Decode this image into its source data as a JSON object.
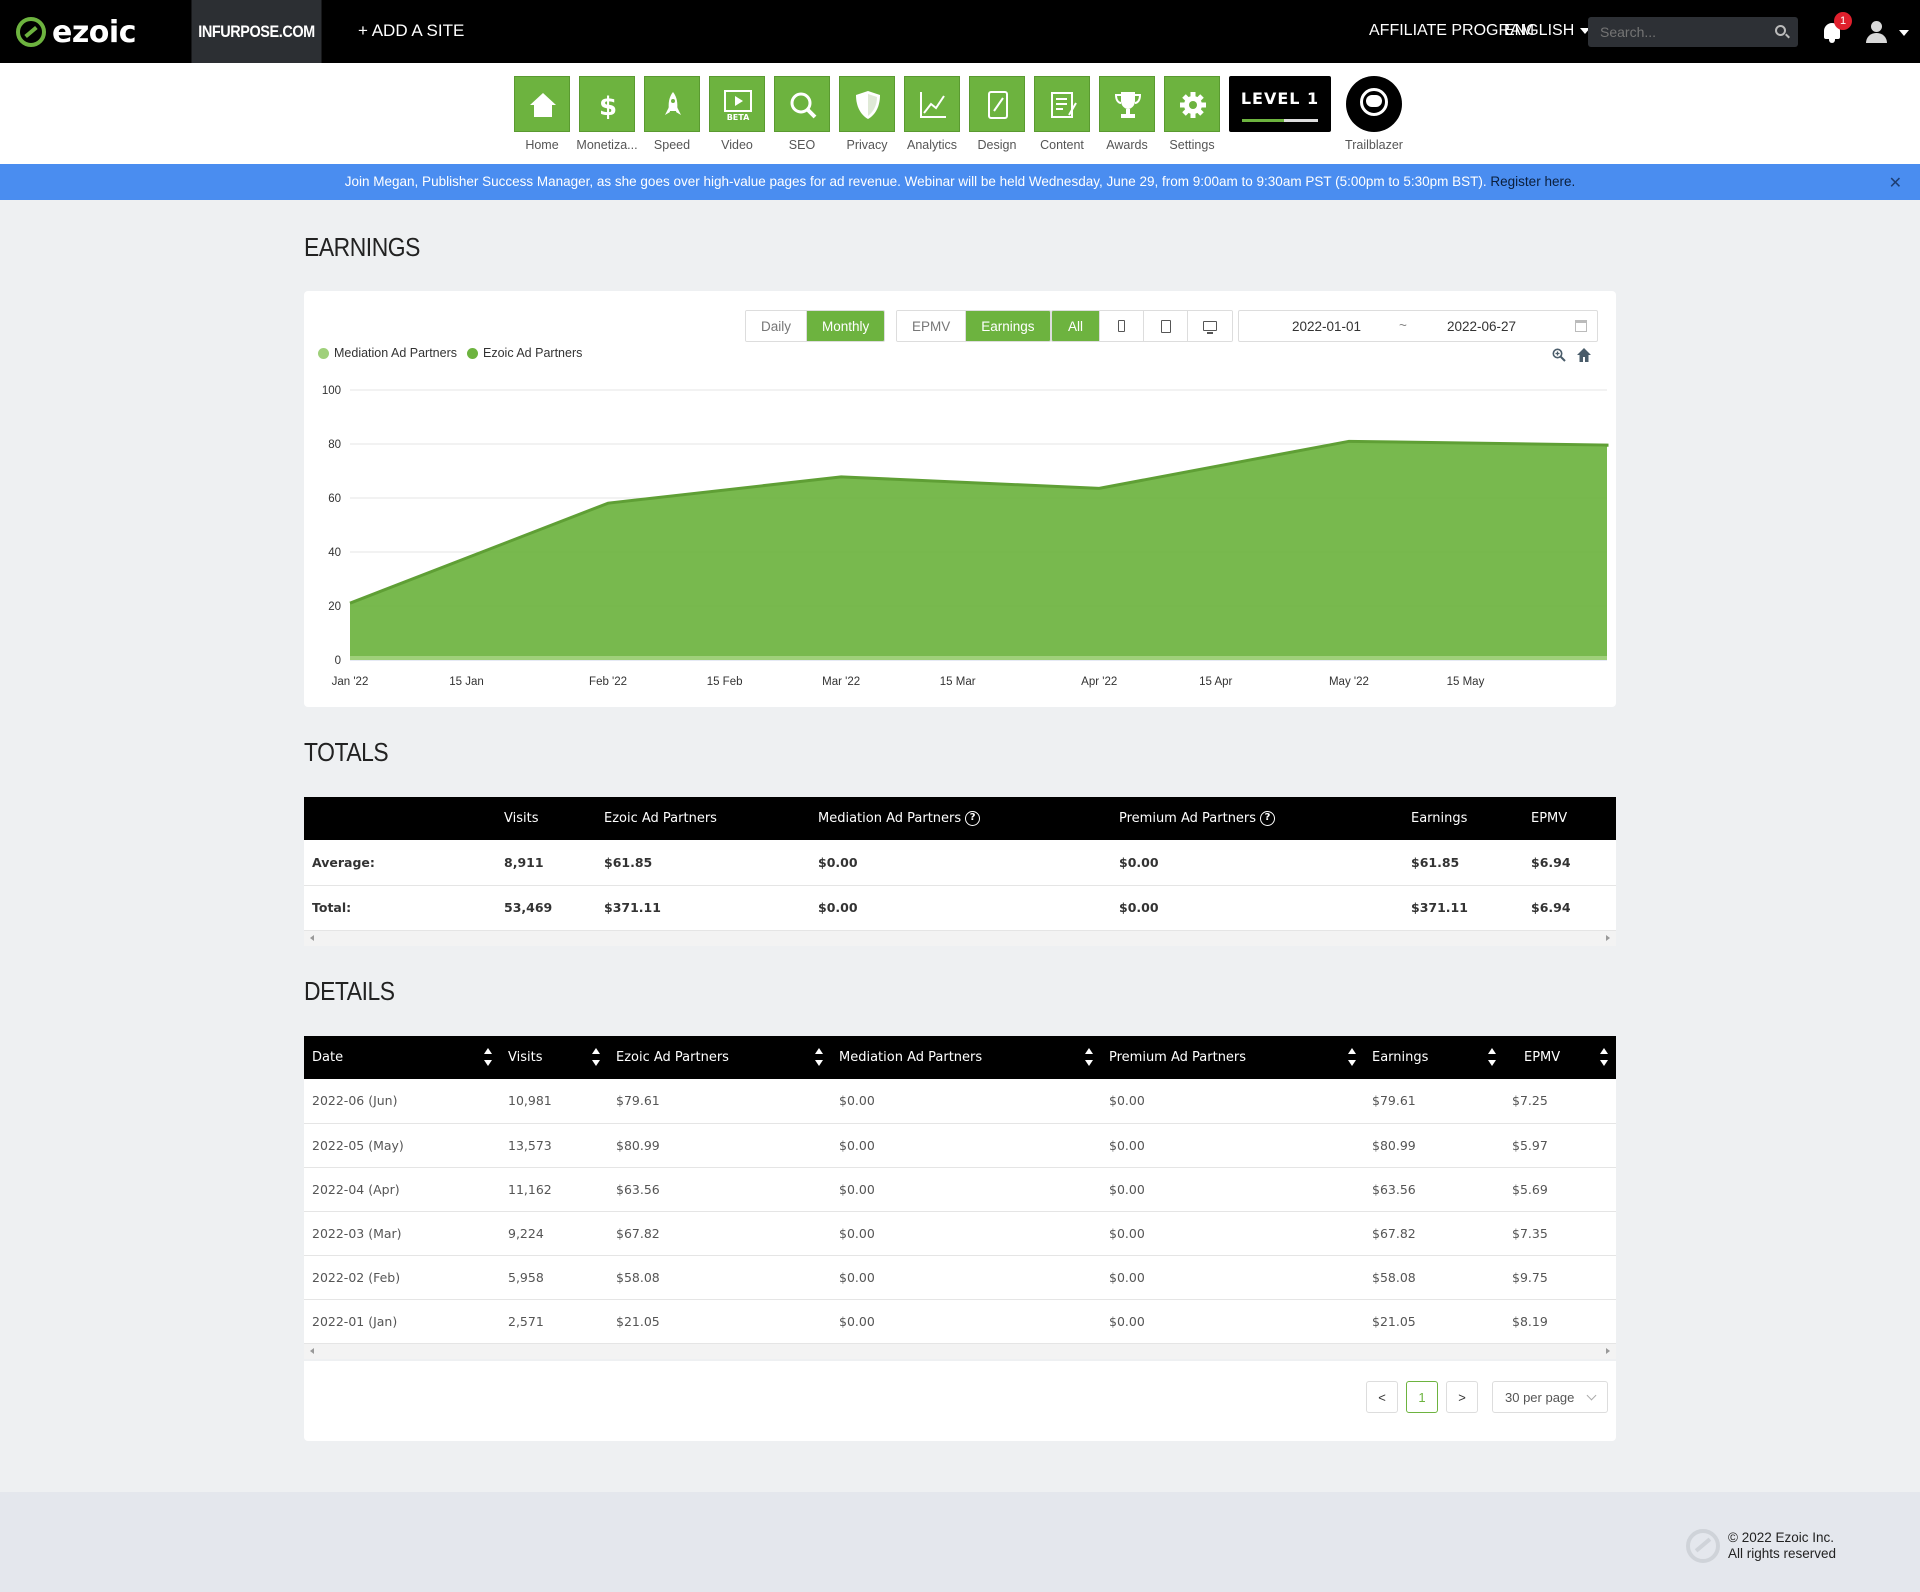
{
  "header": {
    "brand": "ezoic",
    "site": "INFURPOSE.COM",
    "add_site": "+ ADD A SITE",
    "affiliate": "AFFILIATE PROGRAM",
    "language": "ENGLISH",
    "search_placeholder": "Search...",
    "notifications": "1"
  },
  "nav": {
    "items": [
      {
        "label": "Home",
        "icon": "home-icon"
      },
      {
        "label": "Monetiza...",
        "icon": "dollar-icon"
      },
      {
        "label": "Speed",
        "icon": "rocket-icon"
      },
      {
        "label": "Video",
        "icon": "video-icon",
        "badge": "BETA"
      },
      {
        "label": "SEO",
        "icon": "magnifier-icon"
      },
      {
        "label": "Privacy",
        "icon": "shield-icon"
      },
      {
        "label": "Analytics",
        "icon": "line-chart-icon"
      },
      {
        "label": "Design",
        "icon": "design-icon"
      },
      {
        "label": "Content",
        "icon": "document-icon"
      },
      {
        "label": "Awards",
        "icon": "trophy-icon"
      },
      {
        "label": "Settings",
        "icon": "gear-icon"
      }
    ],
    "level": "LEVEL 1",
    "level_progress": 0.55,
    "trailblazer": "Trailblazer"
  },
  "announcement": {
    "text": "Join Megan, Publisher Success Manager, as she goes over high-value pages for ad revenue. Webinar will be held Wednesday, June 29, from 9:00am to 9:30am PST (5:00pm to 5:30pm BST).",
    "link": "Register here."
  },
  "earnings": {
    "title": "EARNINGS",
    "period_buttons": [
      "Daily",
      "Monthly"
    ],
    "metric_buttons": [
      "EPMV",
      "Earnings"
    ],
    "device_all": "All",
    "date_from": "2022-01-01",
    "date_sep": "~",
    "date_to": "2022-06-27"
  },
  "chart_data": {
    "type": "area",
    "legend": [
      "Mediation Ad Partners",
      "Ezoic Ad Partners"
    ],
    "colors": {
      "Mediation Ad Partners": "#9fd07a",
      "Ezoic Ad Partners": "#6db33f"
    },
    "x_ticks": [
      "Jan '22",
      "15 Jan",
      "Feb '22",
      "15 Feb",
      "Mar '22",
      "15 Mar",
      "Apr '22",
      "15 Apr",
      "May '22",
      "15 May"
    ],
    "y_ticks": [
      "0",
      "20",
      "40",
      "60",
      "80",
      "100"
    ],
    "ylim": [
      0,
      100
    ],
    "series": [
      {
        "name": "Ezoic Ad Partners",
        "dates": [
          "2022-01-01",
          "2022-02-01",
          "2022-03-01",
          "2022-04-01",
          "2022-05-01",
          "2022-06-01"
        ],
        "values": [
          21.05,
          58.08,
          67.82,
          63.56,
          80.99,
          79.61
        ]
      },
      {
        "name": "Mediation Ad Partners",
        "dates": [
          "2022-01-01",
          "2022-02-01",
          "2022-03-01",
          "2022-04-01",
          "2022-05-01",
          "2022-06-01"
        ],
        "values": [
          0,
          0,
          0,
          0,
          0,
          0
        ]
      }
    ],
    "legend_position": "top-left",
    "grid": true
  },
  "totals": {
    "title": "TOTALS",
    "columns": [
      "",
      "Visits",
      "Ezoic Ad Partners",
      "Mediation Ad Partners",
      "Premium Ad Partners",
      "Earnings",
      "EPMV"
    ],
    "rows": [
      [
        "Average:",
        "8,911",
        "$61.85",
        "$0.00",
        "$0.00",
        "$61.85",
        "$6.94"
      ],
      [
        "Total:",
        "53,469",
        "$371.11",
        "$0.00",
        "$0.00",
        "$371.11",
        "$6.94"
      ]
    ]
  },
  "details": {
    "title": "DETAILS",
    "columns": [
      "Date",
      "Visits",
      "Ezoic Ad Partners",
      "Mediation Ad Partners",
      "Premium Ad Partners",
      "Earnings",
      "EPMV"
    ],
    "rows": [
      [
        "2022-06 (Jun)",
        "10,981",
        "$79.61",
        "$0.00",
        "$0.00",
        "$79.61",
        "$7.25"
      ],
      [
        "2022-05 (May)",
        "13,573",
        "$80.99",
        "$0.00",
        "$0.00",
        "$80.99",
        "$5.97"
      ],
      [
        "2022-04 (Apr)",
        "11,162",
        "$63.56",
        "$0.00",
        "$0.00",
        "$63.56",
        "$5.69"
      ],
      [
        "2022-03 (Mar)",
        "9,224",
        "$67.82",
        "$0.00",
        "$0.00",
        "$67.82",
        "$7.35"
      ],
      [
        "2022-02 (Feb)",
        "5,958",
        "$58.08",
        "$0.00",
        "$0.00",
        "$58.08",
        "$9.75"
      ],
      [
        "2022-01 (Jan)",
        "2,571",
        "$21.05",
        "$0.00",
        "$0.00",
        "$21.05",
        "$8.19"
      ]
    ]
  },
  "pagination": {
    "prev": "<",
    "page": "1",
    "next": ">",
    "per_page": "30 per page"
  },
  "footer": {
    "copyright": "© 2022 Ezoic Inc.",
    "rights": "All rights reserved"
  }
}
